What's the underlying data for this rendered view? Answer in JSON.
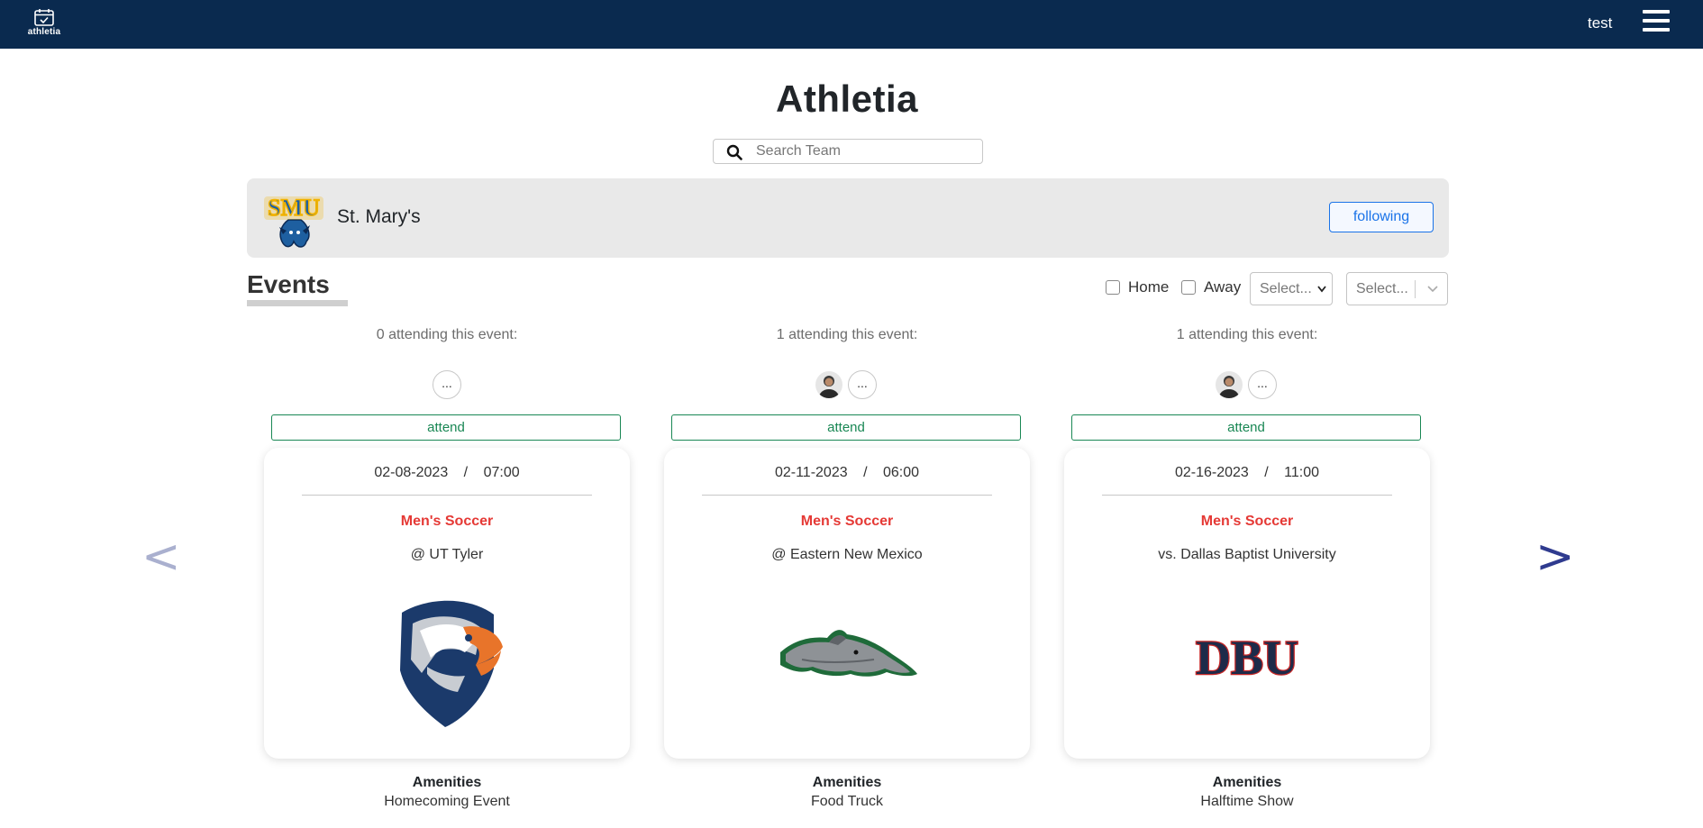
{
  "app": {
    "brand": "athletia",
    "user": "test"
  },
  "page": {
    "title": "Athletia"
  },
  "search": {
    "placeholder": "Search Team"
  },
  "team": {
    "name": "St. Mary's",
    "follow_label": "following",
    "logo_text": "SMU"
  },
  "events": {
    "title": "Events",
    "filters": {
      "home_label": "Home",
      "away_label": "Away",
      "select1_placeholder": "Select...",
      "select2_placeholder": "Select..."
    },
    "amenities_label": "Amenities",
    "attend_label": "attend",
    "more_label": "...",
    "items": [
      {
        "attending_text": "0 attending this event:",
        "date": "02-08-2023",
        "time": "07:00",
        "sport": "Men's Soccer",
        "opponent": "@ UT Tyler",
        "amenity": "Homecoming Event",
        "logo": "eagle-logo",
        "logo_text": ""
      },
      {
        "attending_text": "1 attending this event:",
        "date": "02-11-2023",
        "time": "06:00",
        "sport": "Men's Soccer",
        "opponent": "@ Eastern New Mexico",
        "amenity": "Food Truck",
        "logo": "greyhound-logo",
        "logo_text": ""
      },
      {
        "attending_text": "1 attending this event:",
        "date": "02-16-2023",
        "time": "11:00",
        "sport": "Men's Soccer",
        "opponent": "vs. Dallas Baptist University",
        "amenity": "Halftime Show",
        "logo": "dbu-logo",
        "logo_text": "DBU"
      }
    ]
  },
  "carousel": {
    "prev_label": "<",
    "next_label": ">"
  },
  "colors": {
    "navbar": "#0a2a4f",
    "sport": "#e53935",
    "attend": "#198754",
    "follow": "#1a73e8"
  }
}
